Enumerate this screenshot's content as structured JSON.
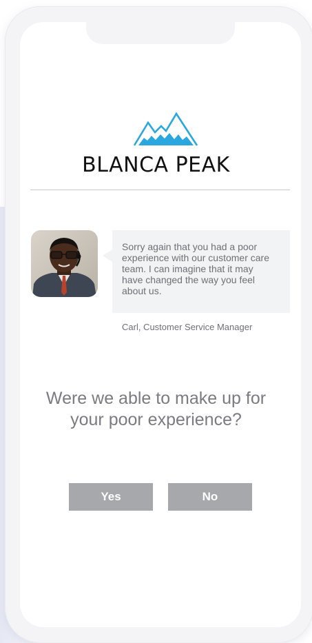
{
  "brand": {
    "name": "BLANCA PEAK",
    "logo_icon": "mountain-peaks-icon",
    "accent_color": "#2aa7df"
  },
  "message": {
    "text": "Sorry again that you had a poor experience with our customer care team. I can imagine that it may have changed the way you feel about us.",
    "signature": "Carl, Customer Service Manager"
  },
  "question": {
    "text": "Were we able to make up for your poor experience?"
  },
  "actions": {
    "yes_label": "Yes",
    "no_label": "No",
    "button_color": "#a7a8ab"
  }
}
